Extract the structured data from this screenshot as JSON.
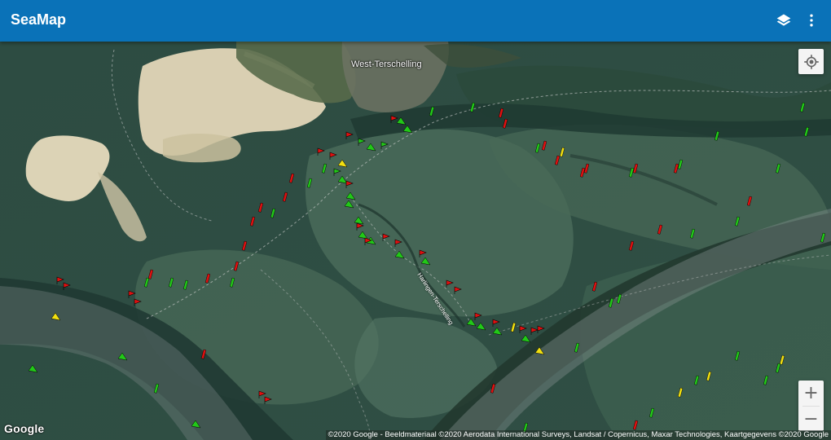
{
  "app": {
    "title": "SeaMap"
  },
  "toolbar": {
    "layers_icon": "layers-icon",
    "menu_icon": "more-vert-icon"
  },
  "map": {
    "town_label": "West-Terschelling",
    "channel_label": "Harlingen-Terschelling",
    "logo": "Google",
    "attribution": "©2020 Google - Beeldmateriaal ©2020 Aerodata International Surveys, Landsat / Copernicus, Maxar Technologies, Kaartgegevens ©2020 Google",
    "locate_icon": "my-location-icon",
    "zoom_in": "+",
    "zoom_out": "−"
  },
  "colors": {
    "appbar": "#0a72b8",
    "water": "#2c4a40",
    "sand": "#d8cfb2",
    "buoy_red": "#e01010",
    "buoy_green": "#22c818",
    "buoy_yellow": "#f2e010"
  }
}
